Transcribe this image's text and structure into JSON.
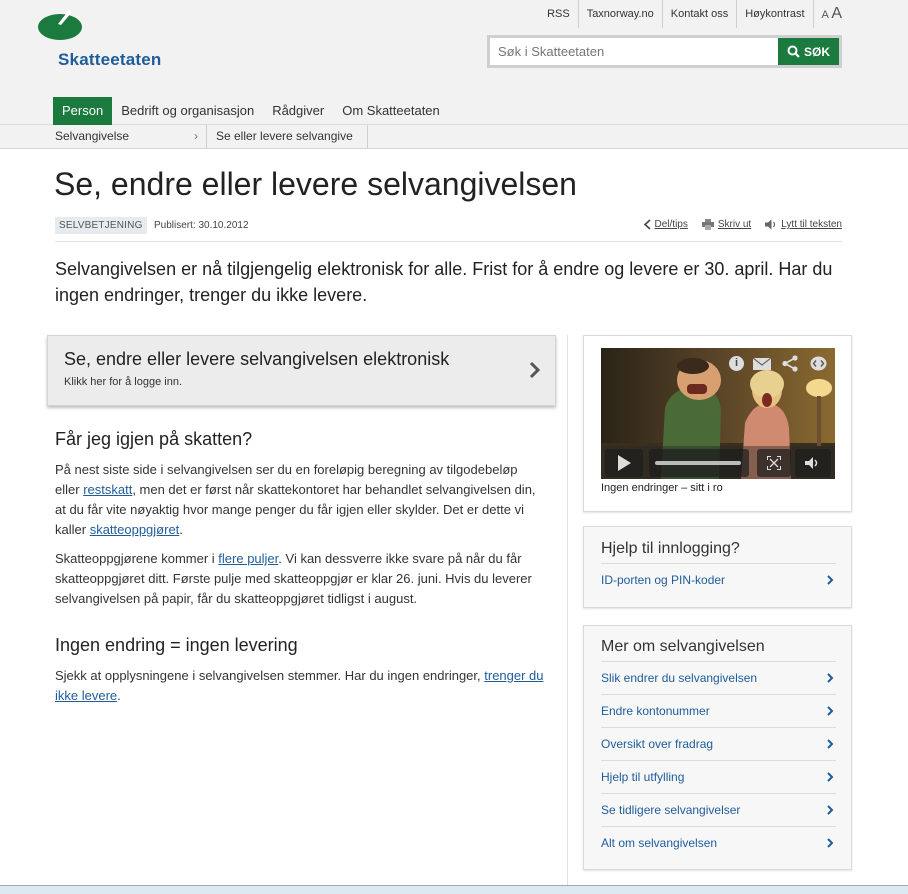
{
  "header": {
    "logo_text": "Skatteetaten",
    "top_links": [
      "RSS",
      "Taxnorway.no",
      "Kontakt oss",
      "Høykontrast"
    ],
    "font_small": "A",
    "font_big": "A",
    "search_placeholder": "Søk i Skatteetaten",
    "search_button": "SØK"
  },
  "main_nav": [
    "Person",
    "Bedrift og organisasjon",
    "Rådgiver",
    "Om Skatteetaten"
  ],
  "breadcrumb": {
    "level1": "Selvangivelse",
    "separator": "›",
    "level2": "Se eller levere selvangive"
  },
  "article": {
    "title": "Se, endre eller levere selvangivelsen",
    "tag": "SELVBETJENING",
    "published": "Publisert: 30.10.2012",
    "tools": {
      "share": "Del/tips",
      "print": "Skriv ut",
      "listen": "Lytt til teksten"
    },
    "intro": "Selvangivelsen er nå tilgjengelig elektronisk for alle. Frist for å endre og levere er 30. april. Har du ingen endringer, trenger du ikke levere.",
    "cta": {
      "title": "Se, endre eller levere selvangivelsen elektronisk",
      "subtitle": "Klikk her for å logge inn."
    },
    "h2_1": "Får jeg igjen på skatten?",
    "p1": {
      "a": "På nest siste side i selvangivelsen ser du en foreløpig beregning av tilgodebeløp eller ",
      "link1": "restskatt",
      "b": ", men det er først når skattekontoret har behandlet selvangivelsen din, at du får vite nøyaktig hvor mange penger du får igjen eller skylder. Det er dette vi kaller ",
      "link2": "skatteoppgjøret",
      "c": "."
    },
    "p2": {
      "a": "Skatteoppgjørene kommer i ",
      "link": "flere puljer",
      "b": ". Vi kan dessverre ikke svare på når du får skatteoppgjøret ditt. Første pulje med skatteoppgjør er klar 26. juni. Hvis du leverer selvangivelsen på papir, får du skatteoppgjøret tidligst i august."
    },
    "h2_2": "Ingen endring = ingen levering",
    "p3": {
      "a": "Sjekk at opplysningene i selvangivelsen stemmer. Har du ingen endringer, ",
      "link": "trenger du ikke levere",
      "b": "."
    }
  },
  "sidebar": {
    "video_caption": "Ingen endringer – sitt i ro",
    "help_box": {
      "title": "Hjelp til innlogging?",
      "items": [
        "ID-porten og PIN-koder"
      ]
    },
    "more_box": {
      "title": "Mer om selvangivelsen",
      "items": [
        "Slik endrer du selvangivelsen",
        "Endre kontonummer",
        "Oversikt over fradrag",
        "Hjelp til utfylling",
        "Se tidligere selvangivelser",
        "Alt om selvangivelsen"
      ]
    }
  },
  "colors": {
    "brand_green": "#1b7a3d",
    "link_blue": "#1f5c9a"
  },
  "icons": [
    "logo-leaf-icon",
    "search-icon",
    "share-icon",
    "print-icon",
    "speaker-icon",
    "chevron-right-icon",
    "info-icon",
    "mail-icon",
    "embed-icon",
    "play-icon",
    "fullscreen-icon",
    "volume-icon"
  ]
}
